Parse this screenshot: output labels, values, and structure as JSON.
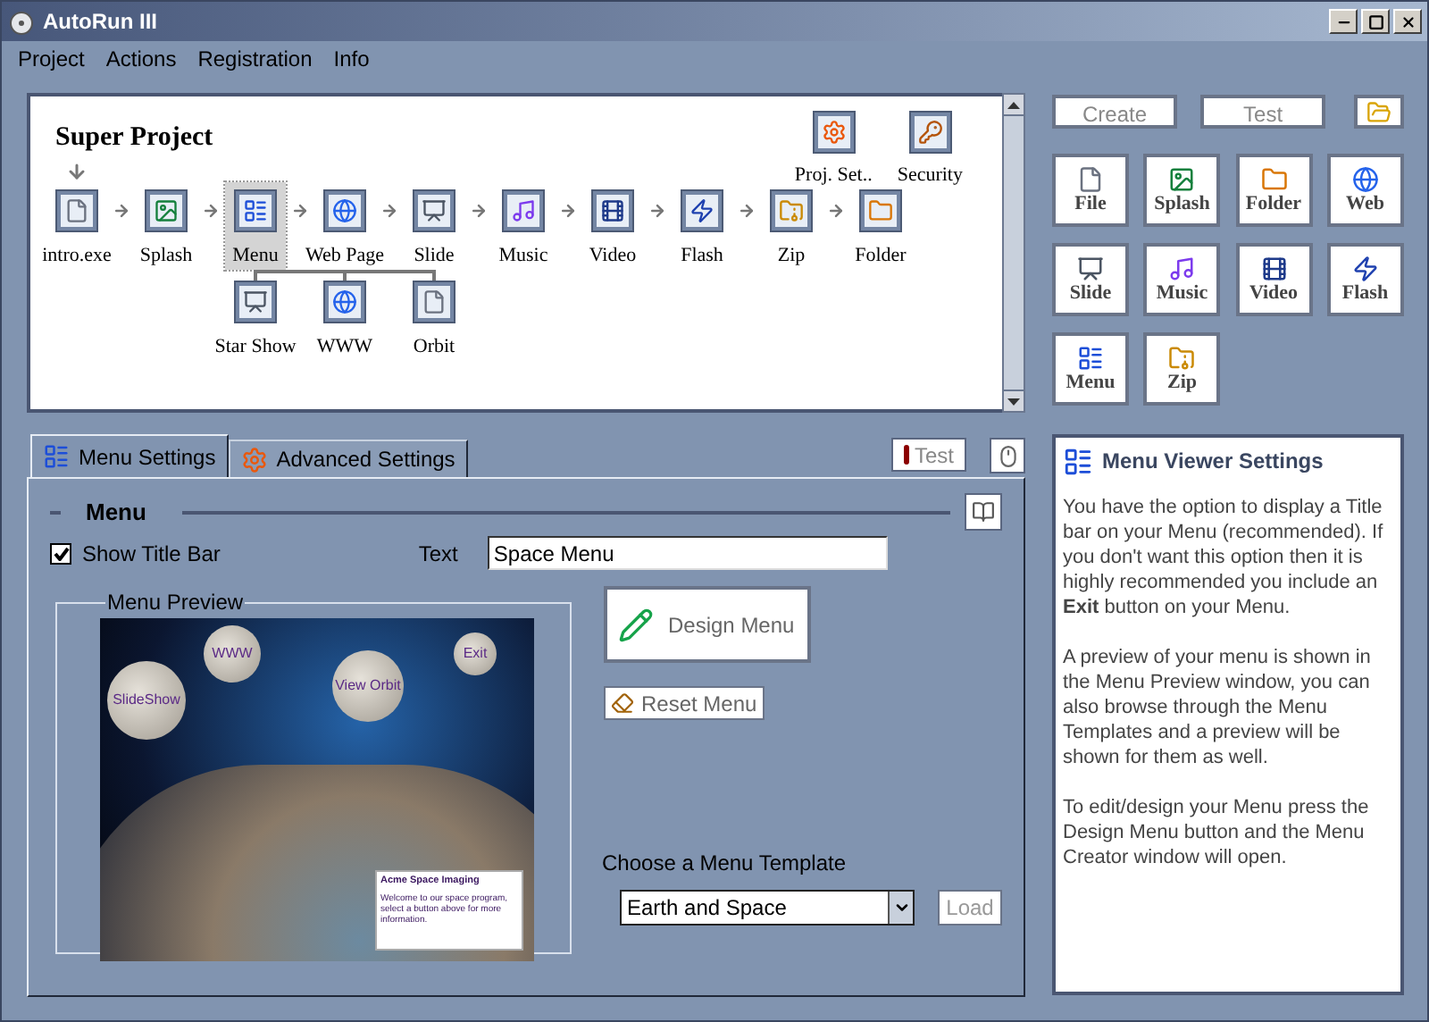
{
  "window": {
    "title": "AutoRun III"
  },
  "menu_bar": [
    {
      "label": "Project"
    },
    {
      "label": "Actions"
    },
    {
      "label": "Registration"
    },
    {
      "label": "Info"
    }
  ],
  "diagram": {
    "title": "Super Project",
    "nodes": [
      {
        "label": "intro.exe",
        "kind": "file",
        "selected": false
      },
      {
        "label": "Splash",
        "kind": "splash",
        "selected": false
      },
      {
        "label": "Menu",
        "kind": "menu",
        "selected": true
      },
      {
        "label": "Web Page",
        "kind": "web",
        "selected": false
      },
      {
        "label": "Slide",
        "kind": "slide",
        "selected": false
      },
      {
        "label": "Music",
        "kind": "music",
        "selected": false
      },
      {
        "label": "Video",
        "kind": "video",
        "selected": false
      },
      {
        "label": "Flash",
        "kind": "flash",
        "selected": false
      },
      {
        "label": "Zip",
        "kind": "zip",
        "selected": false
      },
      {
        "label": "Folder",
        "kind": "folder",
        "selected": false
      }
    ],
    "sub_nodes": [
      {
        "label": "Star Show",
        "kind": "slide"
      },
      {
        "label": "WWW",
        "kind": "web"
      },
      {
        "label": "Orbit",
        "kind": "file"
      }
    ],
    "extras": [
      {
        "label": "Proj. Set..",
        "kind": "settings"
      },
      {
        "label": "Security",
        "kind": "security"
      }
    ]
  },
  "toolbox": {
    "buttons": [
      {
        "label": "Create"
      },
      {
        "label": "Test"
      }
    ],
    "tiles": [
      {
        "label": "File",
        "kind": "file"
      },
      {
        "label": "Splash",
        "kind": "splash"
      },
      {
        "label": "Folder",
        "kind": "folder"
      },
      {
        "label": "Web",
        "kind": "web"
      },
      {
        "label": "Slide",
        "kind": "slide"
      },
      {
        "label": "Music",
        "kind": "music"
      },
      {
        "label": "Video",
        "kind": "video"
      },
      {
        "label": "Flash",
        "kind": "flash"
      },
      {
        "label": "Menu",
        "kind": "menu"
      },
      {
        "label": "Zip",
        "kind": "zip"
      }
    ]
  },
  "settings": {
    "tabs": [
      {
        "label": "Menu Settings",
        "kind": "menu",
        "selected": true
      },
      {
        "label": "Advanced Settings",
        "kind": "settings",
        "selected": false
      }
    ],
    "test_button": "Test",
    "section_title": "Menu",
    "show_title_bar": {
      "label": "Show Title Bar",
      "checked": true
    },
    "text_field": {
      "label": "Text",
      "value": "Space Menu"
    },
    "preview": {
      "label": "Menu Preview",
      "buttons": [
        {
          "label": "WWW"
        },
        {
          "label": "Exit"
        },
        {
          "label": "SlideShow"
        },
        {
          "label": "View Orbit"
        }
      ],
      "info_title": "Acme Space Imaging",
      "info_text": "Welcome to our space program, select a button above for more information."
    },
    "design_button": "Design Menu",
    "reset_button": "Reset Menu",
    "template": {
      "label": "Choose a Menu Template",
      "value": "Earth and Space"
    },
    "load_button": "Load"
  },
  "help": {
    "title": "Menu Viewer Settings",
    "paragraphs": [
      "You have the option to display a Title bar on your Menu (recommended). If you don't want this option then it is highly recommended you include an **Exit** button on your Menu.",
      "A preview of your menu is shown in the Menu Preview window, you can also browse through the Menu Templates and a preview will be shown for them as well.",
      "To edit/design your Menu press the Design Menu button and the Menu Creator window will open."
    ]
  }
}
